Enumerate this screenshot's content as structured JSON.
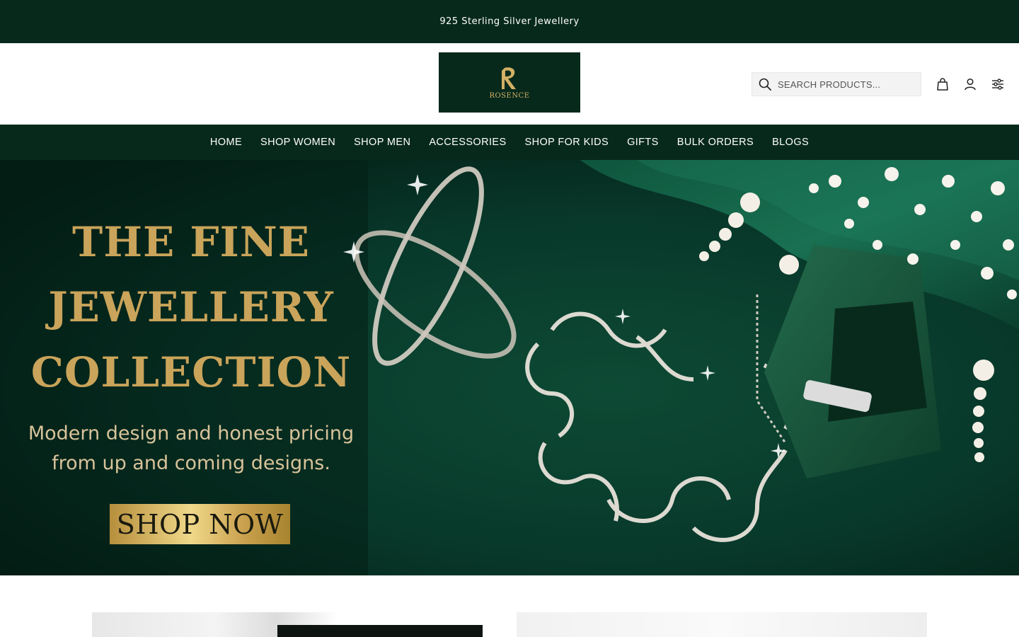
{
  "announcement": {
    "text": "925 Sterling Silver Jewellery"
  },
  "brand": {
    "name": "ROSENCE",
    "monogram": "R",
    "logo_bg": "#07291b",
    "logo_gold": "#d2b065"
  },
  "search": {
    "placeholder": "SEARCH PRODUCTS..."
  },
  "header_icons": [
    "shopping-bag-icon",
    "user-icon",
    "filter-sliders-icon"
  ],
  "nav": {
    "items": [
      {
        "label": "HOME"
      },
      {
        "label": "SHOP WOMEN"
      },
      {
        "label": "SHOP MEN"
      },
      {
        "label": "ACCESSORIES"
      },
      {
        "label": "SHOP FOR KIDS"
      },
      {
        "label": "GIFTS"
      },
      {
        "label": "BULK ORDERS"
      },
      {
        "label": "BLOGS"
      }
    ]
  },
  "hero": {
    "title_lines": [
      "THE FINE",
      "JEWELLERY",
      "COLLECTION"
    ],
    "subtitle_lines": [
      "Modern design and honest pricing",
      "from up and coming designs."
    ],
    "cta_label": "SHOP NOW"
  },
  "colors": {
    "primary_green": "#07291b",
    "gold": "#c9a45a",
    "white": "#ffffff"
  }
}
